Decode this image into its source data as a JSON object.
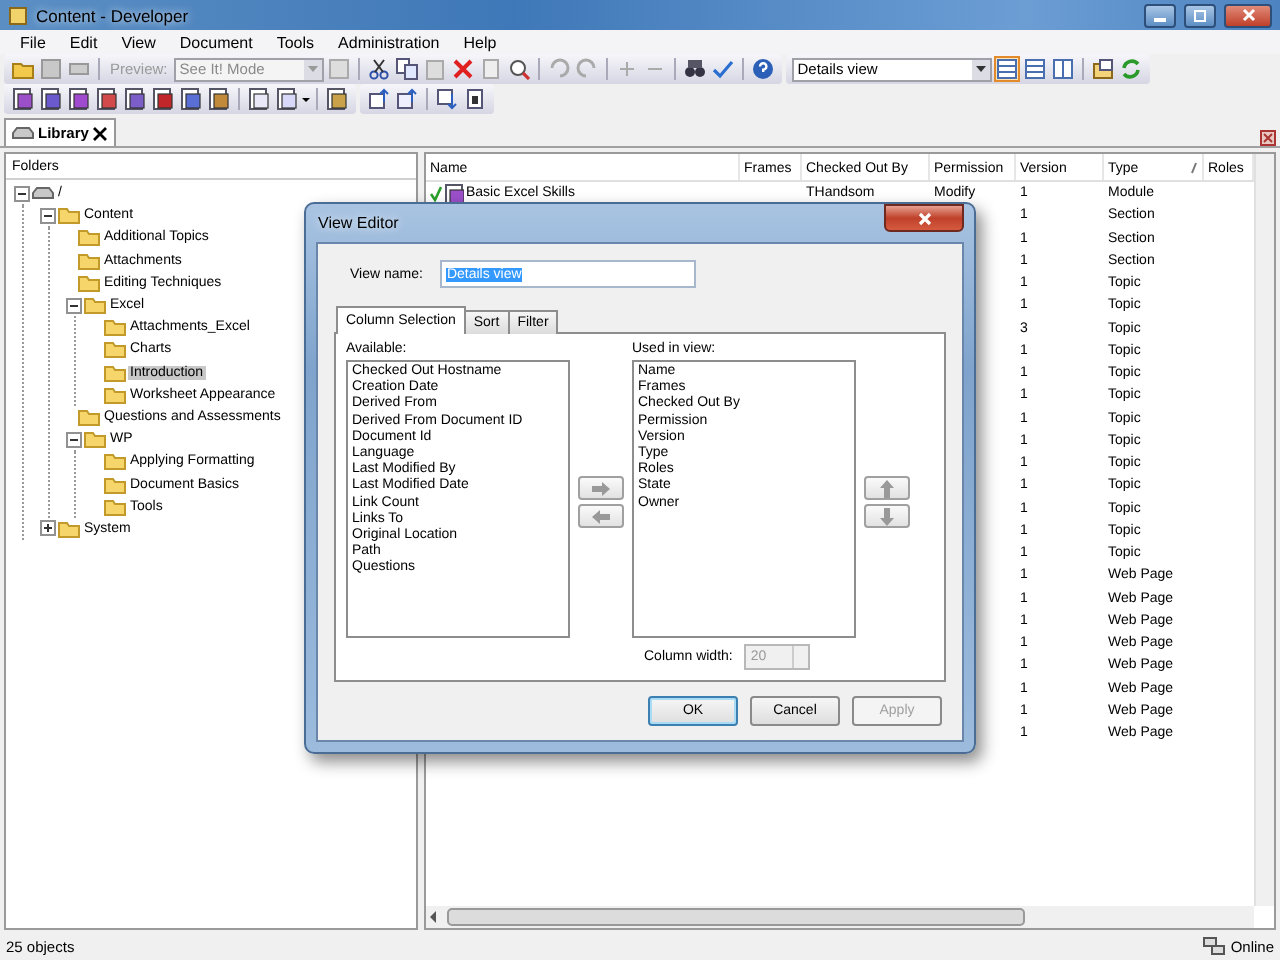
{
  "window": {
    "title": "Content - Developer"
  },
  "menu": [
    "File",
    "Edit",
    "View",
    "Document",
    "Tools",
    "Administration",
    "Help"
  ],
  "toolbar": {
    "preview_label": "Preview:",
    "preview_mode": "See It! Mode",
    "view_select": "Details view"
  },
  "library_tab": {
    "label": "Library"
  },
  "folders": {
    "header": "Folders",
    "tree": [
      {
        "label": "/",
        "expanded": true,
        "selected": false,
        "kind": "drive",
        "children": [
          {
            "label": "Content",
            "expanded": true,
            "selected": false,
            "children": [
              {
                "label": "Additional Topics",
                "selected": false
              },
              {
                "label": "Attachments",
                "selected": false
              },
              {
                "label": "Editing Techniques",
                "selected": false
              },
              {
                "label": "Excel",
                "expanded": true,
                "selected": false,
                "children": [
                  {
                    "label": "Attachments_Excel",
                    "selected": false
                  },
                  {
                    "label": "Charts",
                    "selected": false
                  },
                  {
                    "label": "Introduction",
                    "selected": true
                  },
                  {
                    "label": "Worksheet Appearance",
                    "selected": false
                  }
                ]
              },
              {
                "label": "Questions and Assessments",
                "selected": false
              },
              {
                "label": "WP",
                "expanded": true,
                "selected": false,
                "children": [
                  {
                    "label": "Applying Formatting",
                    "selected": false
                  },
                  {
                    "label": "Document Basics",
                    "selected": false
                  },
                  {
                    "label": "Tools",
                    "selected": false
                  }
                ]
              }
            ]
          },
          {
            "label": "System",
            "expanded": false,
            "selected": false
          }
        ]
      }
    ]
  },
  "table": {
    "columns": [
      "Name",
      "Frames",
      "Checked Out By",
      "Permission",
      "Version",
      "Type",
      "Roles"
    ],
    "rows": [
      {
        "name": "Basic Excel Skills",
        "checked_out_by": "THandsom",
        "permission": "Modify",
        "version": "1",
        "type": "Module"
      },
      {
        "version": "1",
        "type": "Section"
      },
      {
        "version": "1",
        "type": "Section"
      },
      {
        "version": "1",
        "type": "Section"
      },
      {
        "version": "1",
        "type": "Topic"
      },
      {
        "version": "1",
        "type": "Topic"
      },
      {
        "version": "3",
        "type": "Topic"
      },
      {
        "version": "1",
        "type": "Topic"
      },
      {
        "version": "1",
        "type": "Topic"
      },
      {
        "version": "1",
        "type": "Topic"
      },
      {
        "version": "1",
        "type": "Topic"
      },
      {
        "version": "1",
        "type": "Topic"
      },
      {
        "version": "1",
        "type": "Topic"
      },
      {
        "version": "1",
        "type": "Topic"
      },
      {
        "version": "1",
        "type": "Topic"
      },
      {
        "version": "1",
        "type": "Topic"
      },
      {
        "version": "1",
        "type": "Topic"
      },
      {
        "version": "1",
        "type": "Web Page"
      },
      {
        "version": "1",
        "type": "Web Page"
      },
      {
        "version": "1",
        "type": "Web Page"
      },
      {
        "version": "1",
        "type": "Web Page"
      },
      {
        "version": "1",
        "type": "Web Page"
      },
      {
        "version": "1",
        "type": "Web Page"
      },
      {
        "version": "1",
        "type": "Web Page"
      },
      {
        "version": "1",
        "type": "Web Page"
      }
    ]
  },
  "dialog": {
    "title": "View Editor",
    "view_name_label": "View name:",
    "view_name": "Details view",
    "tabs": [
      {
        "label": "Column Selection",
        "selected": true
      },
      {
        "label": "Sort",
        "selected": false
      },
      {
        "label": "Filter",
        "selected": false
      }
    ],
    "available_label": "Available:",
    "available": [
      "Checked Out Hostname",
      "Creation Date",
      "Derived From",
      "Derived From Document ID",
      "Document Id",
      "Language",
      "Last Modified By",
      "Last Modified Date",
      "Link Count",
      "Links To",
      "Original Location",
      "Path",
      "Questions"
    ],
    "used_label": "Used in view:",
    "used": [
      "Name",
      "Frames",
      "Checked Out By",
      "Permission",
      "Version",
      "Type",
      "Roles",
      "State",
      "Owner"
    ],
    "column_width_label": "Column width:",
    "column_width": {
      "value": "20",
      "disabled": true
    },
    "buttons": [
      {
        "label": "OK",
        "default": true,
        "disabled": false
      },
      {
        "label": "Cancel",
        "default": false,
        "disabled": false
      },
      {
        "label": "Apply",
        "default": false,
        "disabled": true
      }
    ]
  },
  "status_bar": {
    "count": "25 objects",
    "connection": "Online"
  }
}
